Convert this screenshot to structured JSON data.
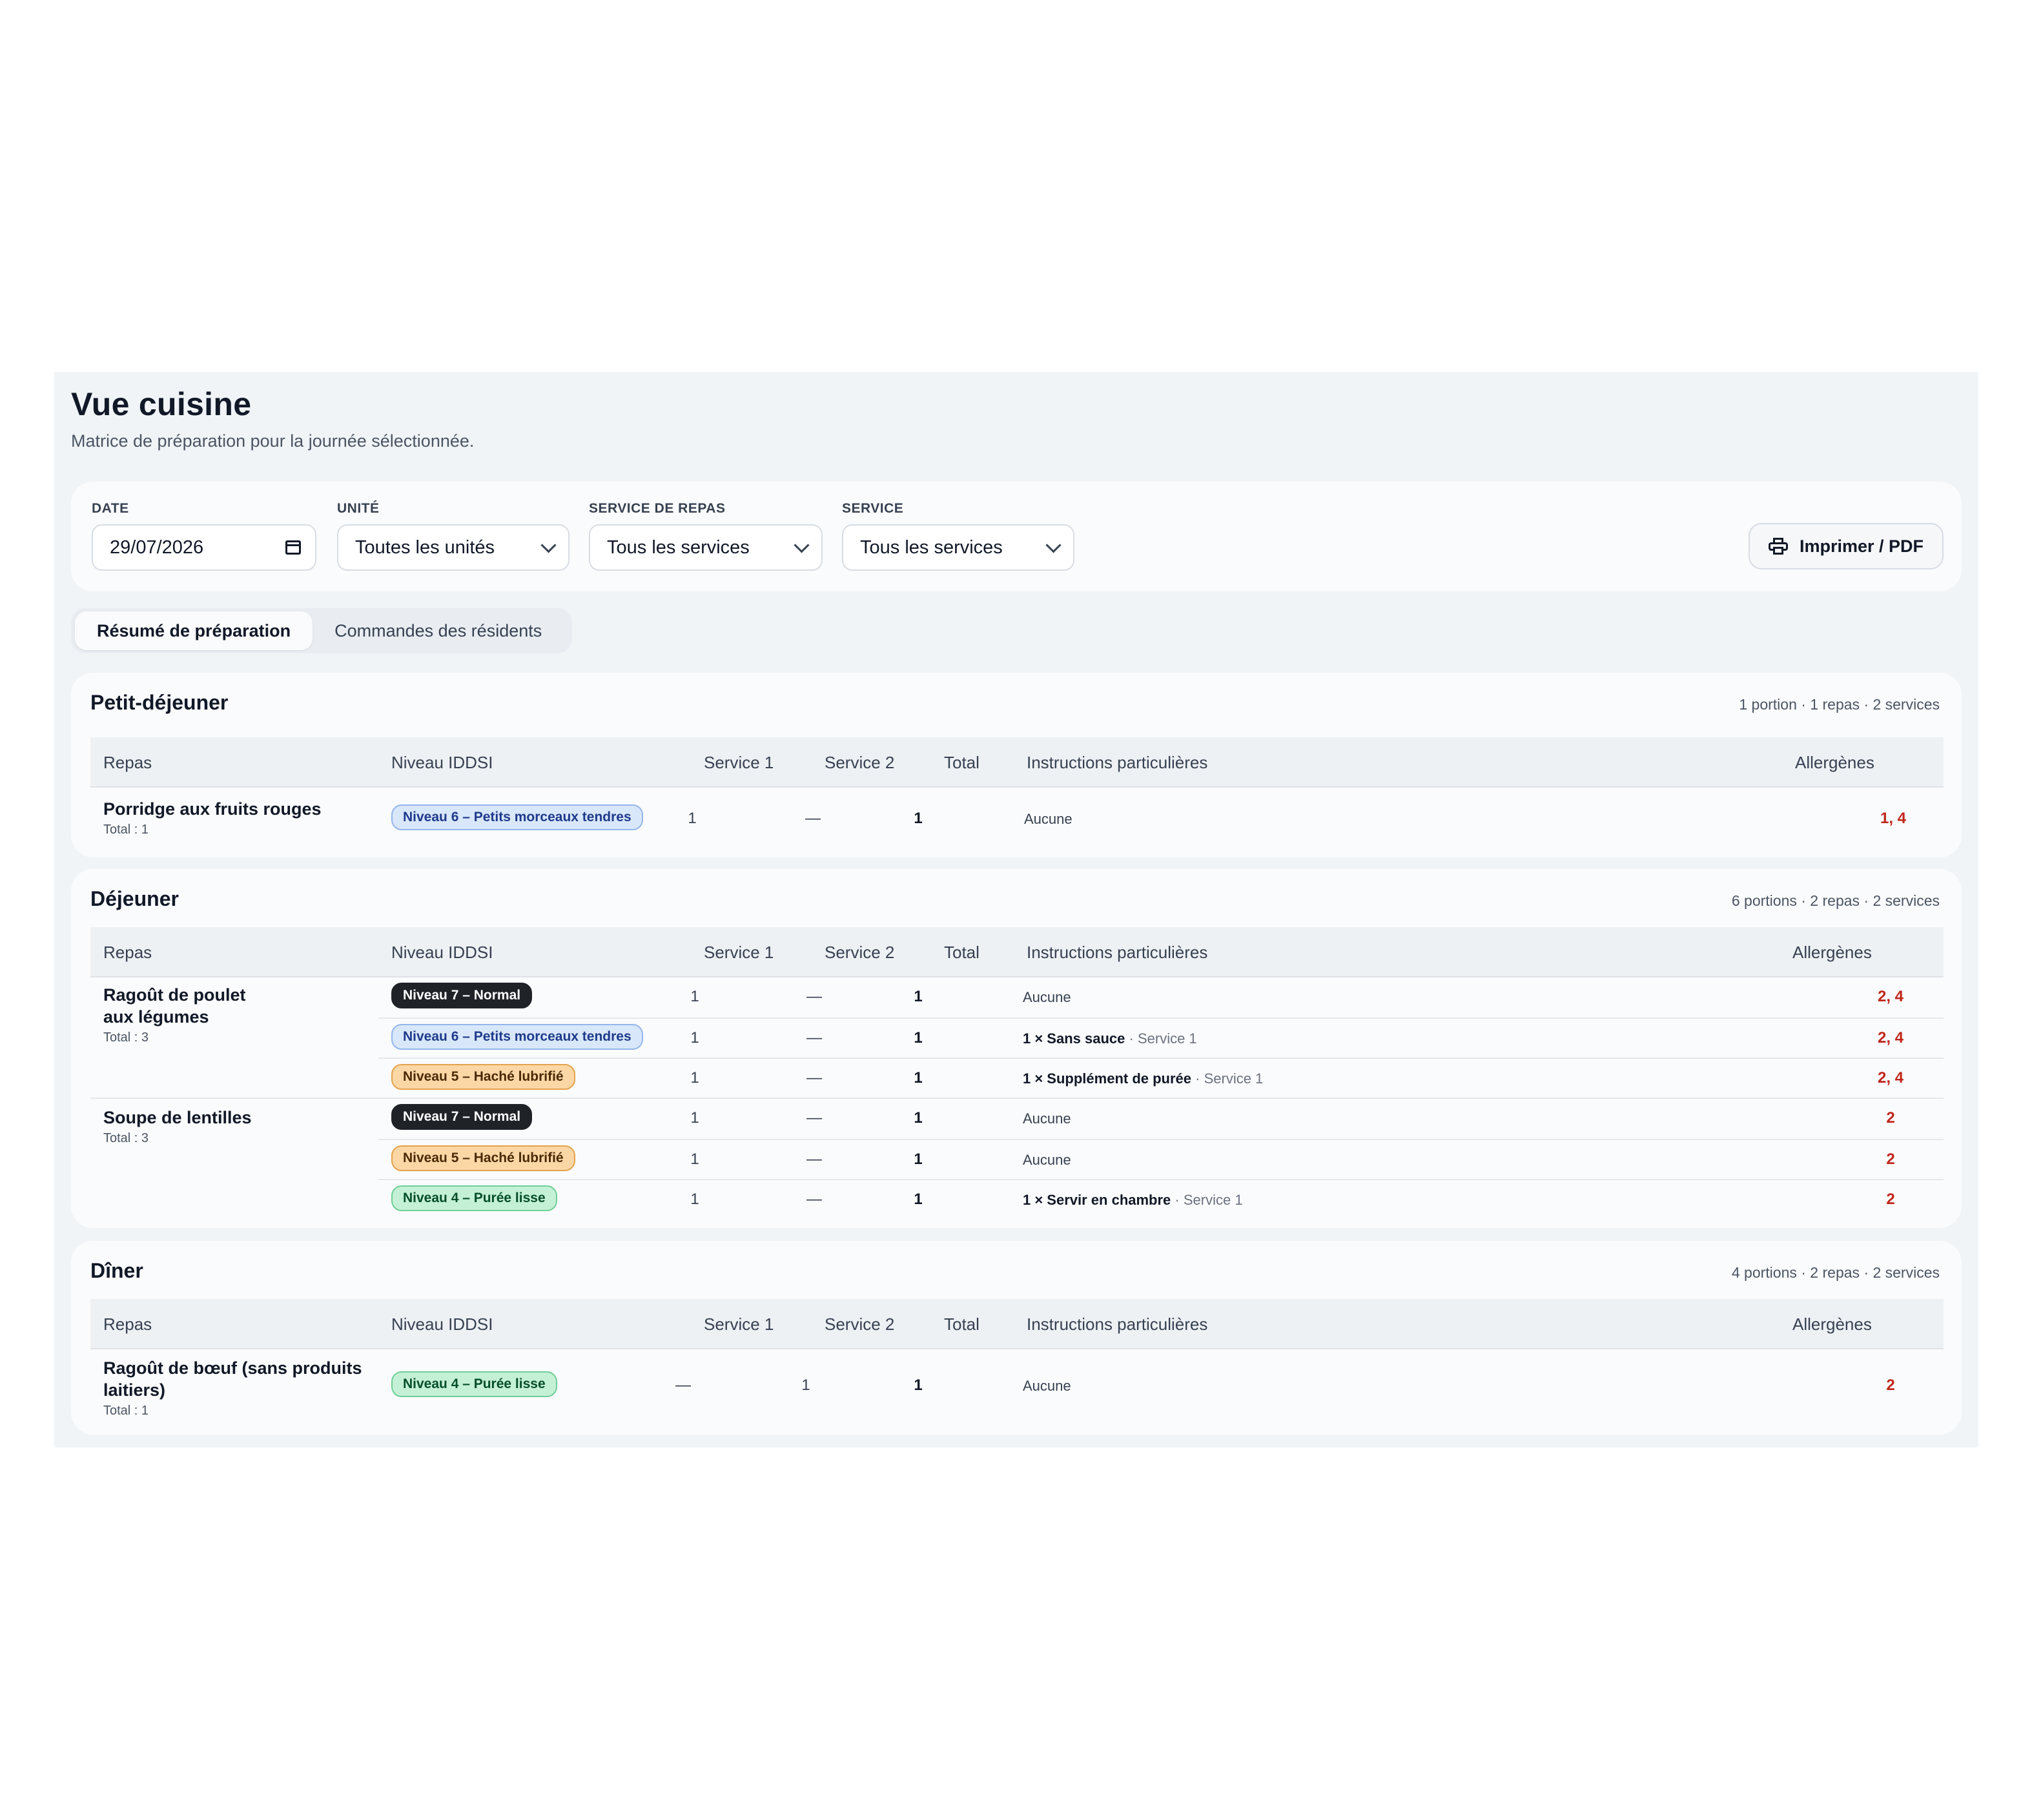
{
  "page": {
    "title": "Vue cuisine",
    "subtitle": "Matrice de préparation pour la journée sélectionnée."
  },
  "filters": {
    "date": {
      "label": "DATE",
      "value": "29/07/2026",
      "icon": "calendar-icon"
    },
    "unit": {
      "label": "UNITÉ",
      "value": "Toutes les unités"
    },
    "meal_service": {
      "label": "SERVICE DE REPAS",
      "value": "Tous les services"
    },
    "service": {
      "label": "SERVICE",
      "value": "Tous les services"
    },
    "print_label": "Imprimer / PDF"
  },
  "tabs": [
    {
      "label": "Résumé de préparation",
      "active": true
    },
    {
      "label": "Commandes des résidents",
      "active": false
    }
  ],
  "table_headers": {
    "meal": "Repas",
    "iddsi": "Niveau IDDSI",
    "service1": "Service 1",
    "service2": "Service 2",
    "total": "Total",
    "instructions": "Instructions particulières",
    "allergens": "Allergènes"
  },
  "sections": [
    {
      "title": "Petit-déjeuner",
      "summary": "1 portion · 1 repas · 2 services",
      "meals": [
        {
          "name": "Porridge aux fruits rouges",
          "total_label": "Total : 1",
          "rows": [
            {
              "level": "Niveau 6 – Petits morceaux tendres",
              "s1": "1",
              "s2": "—",
              "total": "1",
              "instruction": "Aucune",
              "instruction_service": "",
              "allergens": "1, 4"
            }
          ]
        }
      ]
    },
    {
      "title": "Déjeuner",
      "summary": "6 portions · 2 repas · 2 services",
      "meals": [
        {
          "name_line1": "Ragoût de poulet",
          "name_line2": "aux légumes",
          "total_label": "Total : 3",
          "rows": [
            {
              "level": "Niveau 7 – Normal",
              "s1": "1",
              "s2": "—",
              "total": "1",
              "instruction": "Aucune",
              "instruction_service": "",
              "allergens": "2, 4"
            },
            {
              "level": "Niveau 6 – Petits morceaux tendres",
              "s1": "1",
              "s2": "—",
              "total": "1",
              "instruction": "1 × Sans sauce",
              "instruction_service": "· Service 1",
              "allergens": "2, 4"
            },
            {
              "level": "Niveau 5 – Haché lubrifié",
              "s1": "1",
              "s2": "—",
              "total": "1",
              "instruction": "1 × Supplément de purée",
              "instruction_service": "· Service 1",
              "allergens": "2, 4"
            }
          ]
        },
        {
          "name": "Soupe de lentilles",
          "total_label": "Total : 3",
          "rows": [
            {
              "level": "Niveau 7 – Normal",
              "s1": "1",
              "s2": "—",
              "total": "1",
              "instruction": "Aucune",
              "instruction_service": "",
              "allergens": "2"
            },
            {
              "level": "Niveau 5 – Haché lubrifié",
              "s1": "1",
              "s2": "—",
              "total": "1",
              "instruction": "Aucune",
              "instruction_service": "",
              "allergens": "2"
            },
            {
              "level": "Niveau 4 – Purée lisse",
              "s1": "1",
              "s2": "—",
              "total": "1",
              "instruction": "1 × Servir en chambre",
              "instruction_service": "· Service 1",
              "allergens": "2"
            }
          ]
        }
      ]
    },
    {
      "title": "Dîner",
      "summary": "4 portions · 2 repas · 2 services",
      "meals": [
        {
          "name_line1": "Ragoût de bœuf (sans produits",
          "name_line2": "laitiers)",
          "total_label": "Total : 1",
          "rows": [
            {
              "level": "Niveau 4 – Purée lisse",
              "s1": "—",
              "s2": "1",
              "total": "1",
              "instruction": "Aucune",
              "instruction_service": "",
              "allergens": "2"
            }
          ]
        }
      ]
    }
  ],
  "colors": {
    "background": "#f1f4f7",
    "card": "#fafbfc",
    "allergen": "#c0261b",
    "level7": "#1f2328",
    "level6": "#d9e7fb",
    "level5": "#fbd7a6",
    "level4": "#c4f0d6"
  }
}
